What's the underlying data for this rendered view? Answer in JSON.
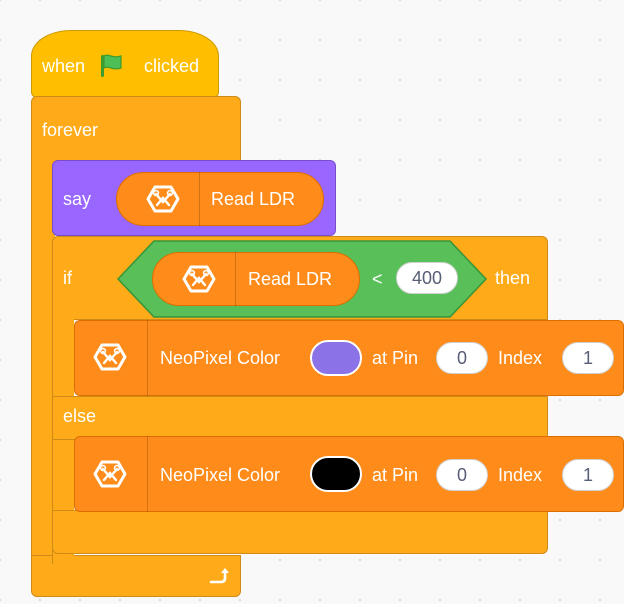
{
  "hat_block": {
    "when_label": "when",
    "flag_icon": "green-flag-icon",
    "clicked_label": "clicked"
  },
  "forever_block": {
    "label": "forever",
    "loop_icon": "loop-arrow-icon"
  },
  "say_block": {
    "label": "say",
    "reporter_label": "Read LDR",
    "reporter_icon": "extension-icon"
  },
  "if_block": {
    "if_label": "if",
    "then_label": "then",
    "else_label": "else",
    "condition": {
      "reporter_label": "Read LDR",
      "operator": "<",
      "value": "400"
    }
  },
  "neopixel_then": {
    "label": "NeoPixel Color",
    "color": "#8B72E6",
    "pin_label": "at Pin",
    "pin_value": "0",
    "index_label": "Index",
    "index_value": "1"
  },
  "neopixel_else": {
    "label": "NeoPixel Color",
    "color": "#000000",
    "pin_label": "at Pin",
    "pin_value": "0",
    "index_label": "Index",
    "index_value": "1"
  },
  "colors": {
    "events": "#FFBF00",
    "control": "#FFAB19",
    "looks": "#9966FF",
    "operators": "#59C059",
    "extension": "#FF8C1A"
  }
}
